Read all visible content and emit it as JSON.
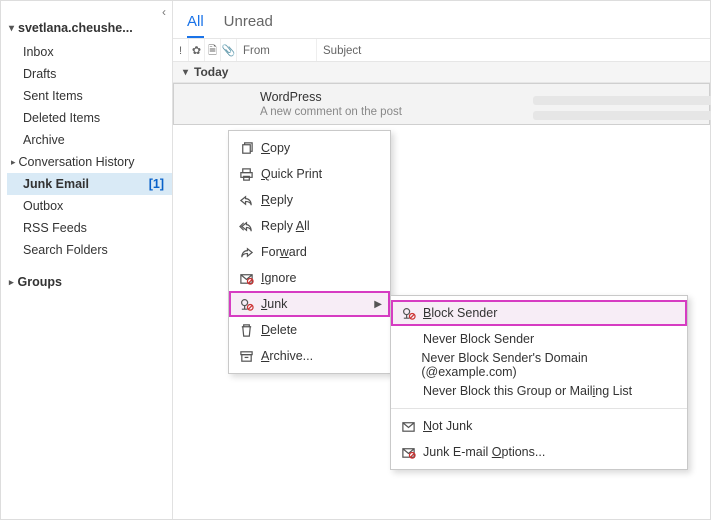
{
  "sidebar": {
    "account_name": "svetlana.cheushe...",
    "folders": [
      {
        "label": "Inbox"
      },
      {
        "label": "Drafts"
      },
      {
        "label": "Sent Items"
      },
      {
        "label": "Deleted Items"
      },
      {
        "label": "Archive"
      },
      {
        "label": "Conversation History",
        "has_children": true
      },
      {
        "label": "Junk Email",
        "selected": true,
        "unread_count": "[1]"
      },
      {
        "label": "Outbox"
      },
      {
        "label": "RSS Feeds"
      },
      {
        "label": "Search Folders"
      }
    ],
    "groups_label": "Groups"
  },
  "main": {
    "tabs": {
      "all": "All",
      "unread": "Unread"
    },
    "columns": {
      "from": "From",
      "subject": "Subject"
    },
    "group_header": "Today",
    "message": {
      "from": "WordPress",
      "subject": "A new comment on the post"
    }
  },
  "context_menu": {
    "items": [
      {
        "icon": "copy",
        "label": "Copy",
        "u": 0
      },
      {
        "icon": "print",
        "label": "Quick Print",
        "u": 0
      },
      {
        "icon": "reply",
        "label": "Reply",
        "u": 0
      },
      {
        "icon": "replyall",
        "label": "Reply All",
        "u": 6
      },
      {
        "icon": "forward",
        "label": "Forward",
        "u": 3
      },
      {
        "icon": "ignore",
        "label": "Ignore",
        "u": 0
      },
      {
        "icon": "junk",
        "label": "Junk",
        "u": 0,
        "submenu": true,
        "highlight": true
      },
      {
        "icon": "delete",
        "label": "Delete",
        "u": 0
      },
      {
        "icon": "archive",
        "label": "Archive...",
        "u": 0
      }
    ],
    "sub_items": [
      {
        "icon": "block",
        "label": "Block Sender",
        "u": 0,
        "highlight": true
      },
      {
        "icon": "",
        "label": "Never Block Sender"
      },
      {
        "icon": "",
        "label": "Never Block Sender's Domain (@example.com)"
      },
      {
        "icon": "",
        "label": "Never Block this Group or Mailing List",
        "u": 30
      },
      {
        "icon": "notjunk",
        "label": "Not Junk",
        "u": 0
      },
      {
        "icon": "options",
        "label": "Junk E-mail Options...",
        "u": 12
      }
    ]
  }
}
